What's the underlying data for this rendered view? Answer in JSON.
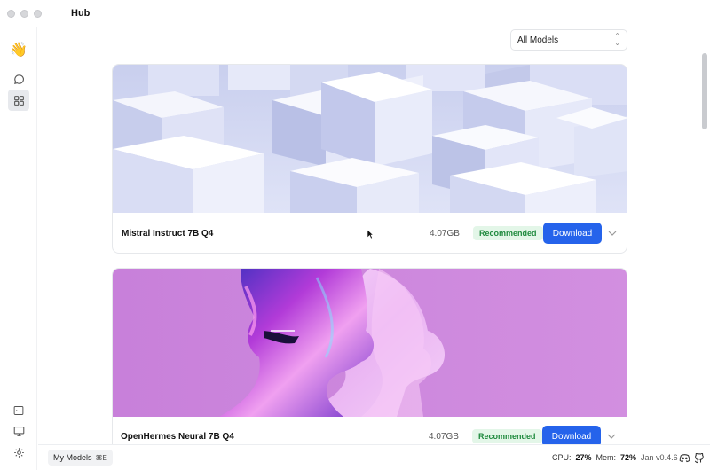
{
  "window": {
    "title": "Hub"
  },
  "sidebar": {
    "items": [
      {
        "icon": "waving-hand-icon",
        "label": "👋"
      },
      {
        "icon": "chat-bubble-icon"
      },
      {
        "icon": "grid-icon"
      },
      {
        "icon": "terminal-icon"
      },
      {
        "icon": "monitor-icon"
      },
      {
        "icon": "gear-icon"
      }
    ]
  },
  "hub": {
    "filter": {
      "selected": "All Models",
      "icon": "updown-caret-icon"
    },
    "models": [
      {
        "name": "Mistral Instruct 7B Q4",
        "size": "4.07GB",
        "badge": "Recommended",
        "download_label": "Download",
        "banner": "blue-cubes"
      },
      {
        "name": "OpenHermes Neural 7B Q4",
        "size": "4.07GB",
        "badge": "Recommended",
        "download_label": "Download",
        "banner": "purple-faces"
      }
    ]
  },
  "statusbar": {
    "my_models": {
      "label": "My Models",
      "shortcut": "⌘E"
    },
    "cpu_label": "CPU:",
    "cpu_value": "27%",
    "mem_label": "Mem:",
    "mem_value": "72%",
    "version": "Jan v0.4.6",
    "icons": [
      "discord-icon",
      "github-icon"
    ]
  },
  "colors": {
    "accent": "#2563eb",
    "badge_bg": "#e3f6e8",
    "badge_text": "#1f8a3e"
  }
}
